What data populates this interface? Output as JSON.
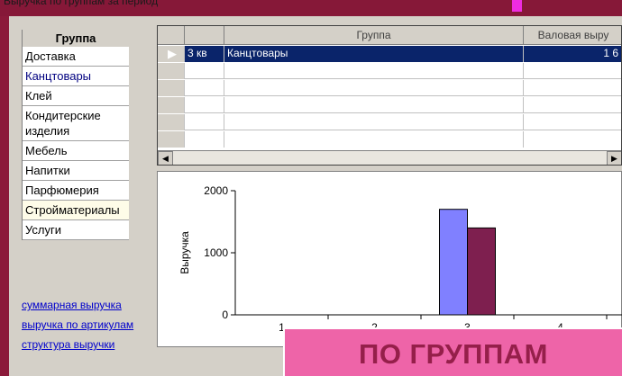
{
  "topbar": {
    "text": "Выручка по группам за период"
  },
  "groups": {
    "header": "Группа",
    "items": [
      "Доставка",
      "Канцтовары",
      "Клей",
      "Кондитерские изделия",
      "Мебель",
      "Напитки",
      "Парфюмерия",
      "Стройматериалы",
      "Услуги"
    ]
  },
  "links": [
    "суммарная выручка",
    "выручка по артикулам",
    "структура выручки"
  ],
  "grid": {
    "columns": [
      "",
      "Группа",
      "Валовая выру"
    ],
    "rows": [
      {
        "period": "3 кв",
        "group": "Канцтовары",
        "value": "1 6"
      }
    ]
  },
  "chart_data": {
    "type": "bar",
    "ylabel": "Выручка",
    "ylim": [
      0,
      2000
    ],
    "yticks": [
      "0",
      "1000",
      "2000"
    ],
    "xticks": [
      "1",
      "2",
      "3",
      "4"
    ],
    "series": [
      {
        "values": [
          0,
          0,
          1700,
          0
        ],
        "color": "#8080ff"
      },
      {
        "values": [
          0,
          0,
          1400,
          0
        ],
        "color": "#7e1f4f"
      }
    ]
  },
  "banner": {
    "text": "ПО ГРУППАМ"
  },
  "colors": {
    "background": "#8b1a3a",
    "selection": "#0a246a",
    "banner": "#ee64a8"
  }
}
